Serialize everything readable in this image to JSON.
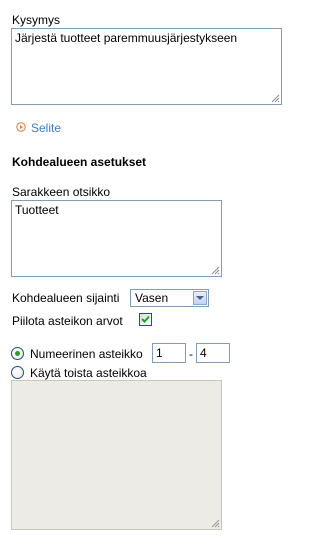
{
  "question": {
    "label": "Kysymys",
    "value": "Järjestä tuotteet paremmuusjärjestykseen"
  },
  "explanation_link": {
    "label": "Selite"
  },
  "target_settings": {
    "heading": "Kohdealueen asetukset",
    "column_title_label": "Sarakkeen otsikko",
    "column_title_value": "Tuotteet",
    "position_label": "Kohdealueen sijainti",
    "position_value": "Vasen",
    "hide_scale_label": "Piilota asteikon arvot",
    "hide_scale_checked": true
  },
  "scale": {
    "numeric_label": "Numeerinen asteikko",
    "numeric_selected": true,
    "range_from": "1",
    "range_separator": "-",
    "range_to": "4",
    "other_label": "Käytä toista asteikkoa",
    "other_selected": false,
    "other_value": ""
  },
  "colors": {
    "link": "#3a7fbf",
    "input_border": "#7f9db9",
    "disabled_textarea": "#ecebe5"
  }
}
